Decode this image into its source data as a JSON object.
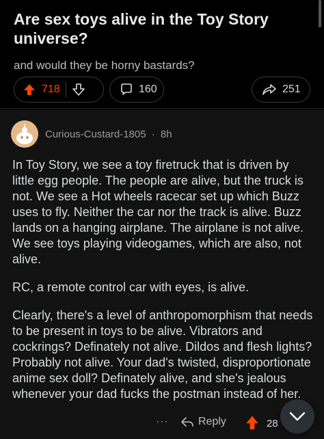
{
  "post": {
    "title": "Are sex toys alive in the Toy Story universe?",
    "subtext": "and would they be horny bastards?",
    "upvotes": "718",
    "comments": "160",
    "shares": "251",
    "upvote_color": "#ff4500"
  },
  "comment": {
    "author": "Curious-Custard-1805",
    "separator": "·",
    "age": "8h",
    "paragraphs": [
      "In Toy Story, we see a toy firetruck that is driven by little egg people. The people are alive, but the truck is not. We see a Hot wheels racecar set up which Buzz uses to fly. Neither the car nor the track is alive. Buzz lands on a hanging airplane. The airplane is not alive. We see toys playing videogames, which are also, not alive.",
      "RC, a remote control car with eyes, is alive.",
      "Clearly, there's a level of anthropomorphism that needs to be present in toys to be alive. Vibrators and cockrings? Definately not alive. Dildos and flesh lights? Probably not alive. Your dad's twisted, disproportionate anime sex doll? Definately alive, and she's jealous whenever your dad fucks the postman instead of her."
    ],
    "more_label": "···",
    "reply_label": "Reply",
    "score_visible": "28"
  },
  "icons": {
    "upvote": "arrow-up-icon",
    "downvote": "arrow-down-icon",
    "comment": "speech-bubble-icon",
    "share": "share-arrow-icon",
    "reply": "reply-arrow-icon",
    "scroll_down": "chevron-down-icon"
  }
}
